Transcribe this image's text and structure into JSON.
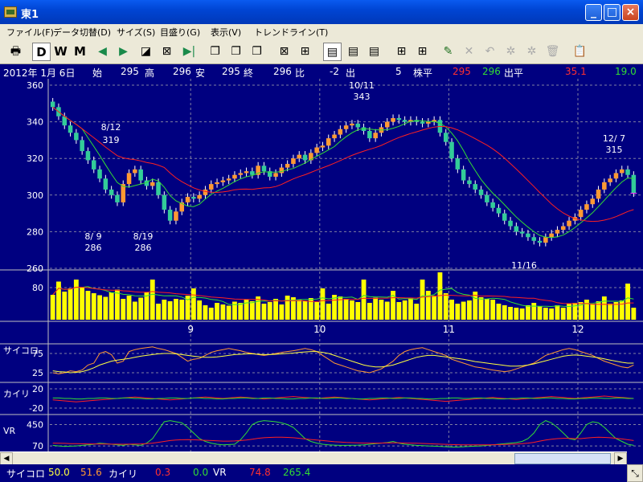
{
  "window": {
    "title": "東1"
  },
  "menu": [
    {
      "label": "ファイル(F)"
    },
    {
      "label": "データ切替(D)"
    },
    {
      "label": "サイズ(S)"
    },
    {
      "label": "目盛り(G)"
    },
    {
      "label": "表示(V)"
    },
    {
      "label": "トレンドライン(T)"
    }
  ],
  "toolbar": {
    "period_daily": "D",
    "period_weekly": "W",
    "period_monthly": "M"
  },
  "info": {
    "date": "2012年 1月 6日",
    "open_label": "始",
    "open": "295",
    "high_label": "高",
    "high": "296",
    "low_label": "安",
    "low": "295",
    "close_label": "終",
    "close": "296",
    "change_label": "比",
    "change": "-2",
    "volume_label": "出",
    "volume": "5",
    "avg_label": "株平",
    "avg1": "295",
    "avg2": "296",
    "vol_avg_label": "出平",
    "vol_avg1": "35.1",
    "vol_avg2": "19.0"
  },
  "status": {
    "psych_label": "サイコロ",
    "psych_v1": "50.0",
    "psych_v2": "51.6",
    "kairi_label": "カイリ",
    "kairi_v1": "0.3",
    "kairi_v2": "0.0",
    "vr_label": "VR",
    "vr_v1": "74.8",
    "vr_v2": "265.4"
  },
  "colors": {
    "background": "#000080",
    "candle_up": "#ff9933",
    "candle_down": "#33cc99",
    "ma_short": "#33dd33",
    "ma_long": "#ff2020",
    "volume_bar": "#ffff00",
    "grid": "#8080a0",
    "text": "#ffffff"
  },
  "chart_data": [
    {
      "type": "candlestick",
      "price_axis": {
        "ticks": [
          "360",
          "340",
          "320",
          "300",
          "280",
          "260"
        ],
        "ylim": [
          260,
          360
        ]
      },
      "x_month_labels": [
        "9",
        "10",
        "11",
        "12"
      ],
      "annotations": [
        {
          "date": "8/12",
          "value": "319"
        },
        {
          "date": "8/ 9",
          "value": "286"
        },
        {
          "date": "8/19",
          "value": "286"
        },
        {
          "date": "10/11",
          "value": "343"
        },
        {
          "date": "11/16",
          "value": ""
        },
        {
          "date": "12/ 7",
          "value": "315"
        }
      ],
      "closes": [
        348,
        343,
        338,
        334,
        330,
        324,
        319,
        314,
        309,
        303,
        300,
        296,
        306,
        312,
        314,
        308,
        305,
        307,
        300,
        292,
        286,
        291,
        296,
        299,
        298,
        300,
        303,
        306,
        307,
        308,
        309,
        311,
        312,
        313,
        311,
        316,
        313,
        310,
        312,
        315,
        317,
        320,
        322,
        319,
        323,
        326,
        327,
        331,
        333,
        336,
        338,
        339,
        337,
        335,
        331,
        334,
        337,
        340,
        342,
        341,
        340,
        341,
        340,
        339,
        340,
        341,
        334,
        329,
        320,
        314,
        308,
        306,
        303,
        300,
        296,
        293,
        290,
        286,
        283,
        280,
        279,
        277,
        275,
        274,
        277,
        279,
        281,
        283,
        286,
        288,
        292,
        295,
        298,
        303,
        307,
        309,
        312,
        314,
        311,
        301
      ]
    },
    {
      "type": "bar",
      "title": "",
      "axis_ticks": [
        "80"
      ],
      "volumes": [
        62,
        95,
        70,
        78,
        100,
        80,
        72,
        66,
        61,
        57,
        68,
        75,
        52,
        60,
        45,
        55,
        68,
        100,
        40,
        50,
        46,
        52,
        50,
        60,
        78,
        48,
        36,
        30,
        42,
        38,
        35,
        45,
        42,
        50,
        46,
        58,
        40,
        44,
        52,
        38,
        60,
        56,
        50,
        46,
        54,
        44,
        78,
        40,
        62,
        58,
        52,
        48,
        44,
        100,
        42,
        55,
        50,
        45,
        72,
        44,
        48,
        54,
        40,
        100,
        72,
        60,
        118,
        66,
        50,
        40,
        45,
        48,
        70,
        56,
        52,
        50,
        40,
        36,
        32,
        30,
        28,
        36,
        42,
        34,
        30,
        28,
        36,
        30,
        40,
        42,
        44,
        50,
        38,
        46,
        58,
        40,
        44,
        48,
        90,
        30
      ]
    },
    {
      "type": "line",
      "title": "サイコロ",
      "axis_ticks": [
        "75",
        "25"
      ],
      "ylim": [
        0,
        100
      ],
      "psych_short": [
        25,
        22,
        25,
        30,
        28,
        32,
        45,
        50,
        75,
        80,
        72,
        50,
        55,
        80,
        85,
        88,
        90,
        92,
        88,
        85,
        80,
        75,
        65,
        55,
        60,
        62,
        70,
        78,
        82,
        85,
        88,
        85,
        82,
        78,
        75,
        72,
        70,
        72,
        75,
        78,
        80,
        82,
        85,
        88,
        85,
        80,
        70,
        60,
        50,
        45,
        40,
        35,
        30,
        28,
        25,
        30,
        35,
        45,
        55,
        70,
        80,
        85,
        88,
        90,
        85,
        80,
        75,
        70,
        60,
        55,
        50,
        45,
        40,
        38,
        35,
        32,
        30,
        28,
        30,
        35,
        40,
        45,
        50,
        60,
        70,
        75,
        80,
        85,
        88,
        85,
        80,
        75,
        70,
        62,
        55,
        50,
        45,
        40,
        38,
        45
      ],
      "psych_long": [
        30,
        28,
        27,
        25,
        26,
        28,
        32,
        38,
        45,
        50,
        55,
        58,
        60,
        62,
        65,
        68,
        70,
        72,
        74,
        75,
        75,
        74,
        72,
        70,
        68,
        66,
        65,
        65,
        66,
        68,
        70,
        72,
        73,
        74,
        74,
        73,
        72,
        72,
        73,
        74,
        75,
        76,
        78,
        79,
        80,
        80,
        78,
        75,
        70,
        65,
        60,
        55,
        50,
        45,
        42,
        40,
        40,
        42,
        45,
        50,
        55,
        60,
        65,
        68,
        70,
        70,
        68,
        66,
        64,
        62,
        60,
        57,
        54,
        52,
        50,
        48,
        46,
        44,
        42,
        42,
        43,
        45,
        48,
        52,
        56,
        60,
        64,
        68,
        70,
        71,
        70,
        68,
        66,
        64,
        61,
        58,
        55,
        52,
        50,
        50
      ]
    },
    {
      "type": "line",
      "title": "カイリ",
      "axis_ticks": [
        "20",
        "-20"
      ],
      "ylim": [
        -30,
        30
      ],
      "kairi": [
        -3,
        -4,
        -5,
        -6,
        -7,
        -6,
        -5,
        -4,
        -3,
        -2,
        -1,
        0,
        1,
        2,
        3,
        2,
        1,
        0,
        -1,
        -2,
        -3,
        -2,
        -1,
        0,
        1,
        2,
        3,
        2,
        1,
        0,
        1,
        2,
        3,
        2,
        1,
        0,
        -1,
        0,
        1,
        2,
        3,
        4,
        3,
        2,
        1,
        0,
        1,
        2,
        3,
        2,
        1,
        0,
        -1,
        -2,
        -3,
        -2,
        -1,
        0,
        1,
        2,
        1,
        0,
        -1,
        -2,
        -3,
        -4,
        -5,
        -6,
        -5,
        -4,
        -3,
        -2,
        -1,
        0,
        1,
        2,
        1,
        0,
        -1,
        -2,
        -1,
        0,
        1,
        2,
        3,
        4,
        3,
        2,
        1,
        0,
        1,
        2,
        3,
        4,
        5,
        4,
        3,
        2,
        1,
        0
      ],
      "kairi2": [
        1,
        1,
        0,
        0,
        -1,
        -1,
        0,
        0,
        1,
        1,
        0,
        0,
        1,
        1,
        0,
        0,
        -1,
        -1,
        0,
        0,
        1,
        1,
        0,
        0,
        1,
        1,
        0,
        0,
        -1,
        -1,
        0,
        0,
        1,
        1,
        0,
        0,
        1,
        1,
        0,
        0,
        -1,
        -1,
        0,
        0,
        1,
        1,
        0,
        0,
        1,
        1,
        0,
        0,
        -1,
        -1,
        0,
        0,
        1,
        1,
        0,
        0,
        1,
        1,
        0,
        0,
        -1,
        -1,
        0,
        0,
        1,
        1,
        0,
        0,
        1,
        1,
        0,
        0,
        -1,
        -1,
        0,
        0,
        1,
        1,
        0,
        0,
        1,
        1,
        0,
        0,
        -1,
        -1,
        0,
        0,
        1,
        1,
        0,
        0,
        1,
        1,
        0,
        0
      ]
    },
    {
      "type": "line",
      "title": "VR",
      "axis_ticks": [
        "450",
        "70"
      ],
      "ylim": [
        0,
        600
      ],
      "vr_short": [
        80,
        70,
        60,
        65,
        70,
        80,
        90,
        100,
        120,
        110,
        100,
        90,
        80,
        100,
        90,
        80,
        120,
        200,
        350,
        500,
        520,
        500,
        480,
        400,
        300,
        200,
        150,
        120,
        100,
        90,
        95,
        100,
        180,
        300,
        450,
        500,
        520,
        510,
        500,
        480,
        450,
        400,
        300,
        200,
        150,
        120,
        100,
        90,
        85,
        80,
        80,
        82,
        85,
        90,
        100,
        110,
        120,
        130,
        150,
        120,
        100,
        90,
        80,
        75,
        70,
        65,
        60,
        55,
        50,
        50,
        55,
        60,
        65,
        70,
        80,
        90,
        100,
        110,
        120,
        130,
        150,
        200,
        300,
        450,
        520,
        480,
        400,
        300,
        200,
        180,
        300,
        450,
        500,
        480,
        400,
        300,
        200,
        150,
        100,
        80
      ],
      "vr_long": [
        120,
        118,
        115,
        112,
        110,
        108,
        106,
        105,
        104,
        103,
        102,
        101,
        100,
        102,
        104,
        106,
        110,
        120,
        135,
        150,
        165,
        175,
        180,
        182,
        180,
        176,
        170,
        165,
        160,
        156,
        155,
        158,
        165,
        175,
        190,
        205,
        215,
        222,
        225,
        225,
        222,
        215,
        205,
        195,
        185,
        175,
        165,
        155,
        145,
        138,
        132,
        128,
        125,
        122,
        120,
        120,
        121,
        123,
        125,
        124,
        122,
        120,
        117,
        114,
        110,
        106,
        102,
        98,
        95,
        92,
        90,
        89,
        88,
        88,
        89,
        91,
        93,
        96,
        100,
        104,
        110,
        120,
        135,
        155,
        175,
        190,
        200,
        205,
        205,
        200,
        200,
        210,
        220,
        225,
        222,
        215,
        205,
        195,
        180,
        165
      ]
    }
  ]
}
